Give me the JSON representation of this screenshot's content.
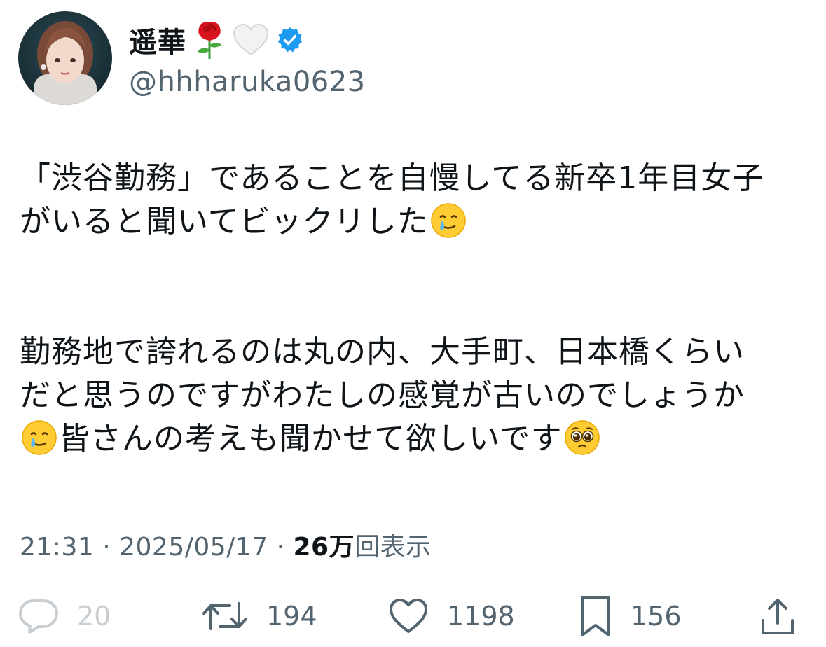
{
  "author": {
    "display_name": "遥華",
    "handle": "@hhharuka0623",
    "name_emojis": [
      "rose-emoji",
      "white-heart-emoji"
    ],
    "verified": true
  },
  "tweet": {
    "paragraphs": [
      [
        "「渋谷勤務」であることを自慢してる新卒1年目女子",
        "がいると聞いてビックリした"
      ],
      [
        "勤務地で誇れるのは丸の内、大手町、日本橋くらい",
        "だと思うのですがわたしの感覚が古いのでしょうか",
        "皆さんの考えも聞かせて欲しいです"
      ]
    ]
  },
  "meta": {
    "time": "21:31",
    "separator": "·",
    "date": "2025/05/17",
    "views_count": "26万",
    "views_label": "回表示"
  },
  "actions": {
    "reply_count": "20",
    "retweet_count": "194",
    "like_count": "1198",
    "bookmark_count": "156"
  },
  "colors": {
    "text": "#0f1419",
    "secondary": "#536471",
    "verified": "#1d9bf0"
  }
}
